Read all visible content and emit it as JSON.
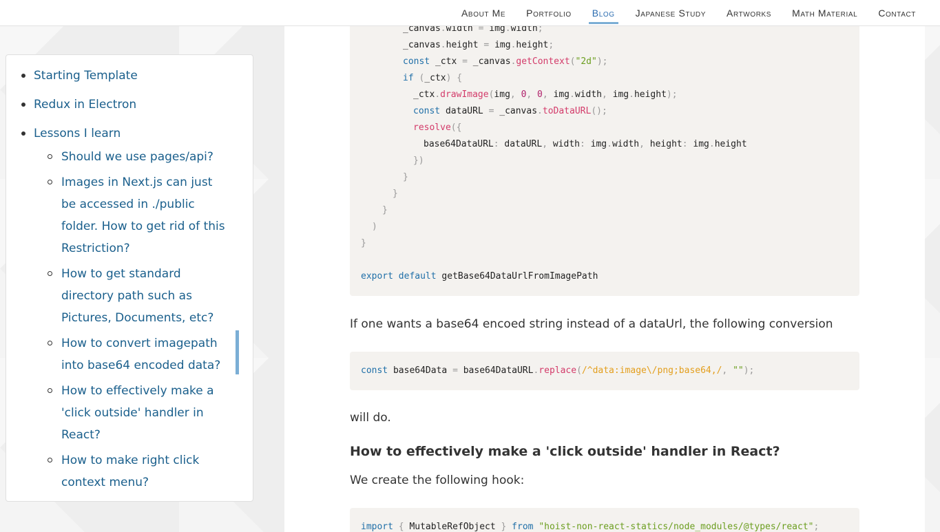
{
  "nav": {
    "items": [
      {
        "label": "About Me",
        "active": false
      },
      {
        "label": "Portfolio",
        "active": false
      },
      {
        "label": "Blog",
        "active": true
      },
      {
        "label": "Japanese Study",
        "active": false
      },
      {
        "label": "Artworks",
        "active": false
      },
      {
        "label": "Math Material",
        "active": false
      },
      {
        "label": "Contact",
        "active": false
      }
    ],
    "accent_color": "#7baed5"
  },
  "toc": {
    "items": [
      {
        "label": "Starting Template"
      },
      {
        "label": "Redux in Electron"
      },
      {
        "label": "Lessons I learn"
      }
    ],
    "sub_items": [
      {
        "label": "Should we use pages/api?"
      },
      {
        "label": "Images in Next.js can just be accessed in ./public folder. How to get rid of this Restriction?"
      },
      {
        "label": "How to get standard directory path such as Pictures, Documents, etc?"
      },
      {
        "label": "How to convert imagepath into base64 encoded data?"
      },
      {
        "label": "How to effectively make a 'click outside' handler in React?"
      },
      {
        "label": "How to make right click context menu?"
      }
    ]
  },
  "code1": {
    "l1_a": "_canvas",
    "l1_b": ".",
    "l1_c": "width",
    "l1_d": " = ",
    "l1_e": "img",
    "l1_f": ".",
    "l1_g": "width",
    "l1_h": ";",
    "l2_a": "_canvas",
    "l2_b": ".",
    "l2_c": "height",
    "l2_d": " = ",
    "l2_e": "img",
    "l2_f": ".",
    "l2_g": "height",
    "l2_h": ";",
    "l3_kw": "const",
    "l3_a": " _ctx ",
    "l3_b": "=",
    "l3_c": " _canvas",
    "l3_d": ".",
    "l3_fn": "getContext",
    "l3_e": "(",
    "l3_str": "\"2d\"",
    "l3_f": ");",
    "l4_kw": "if",
    "l4_a": " (",
    "l4_b": "_ctx",
    "l4_c": ") {",
    "l5_a": "_ctx",
    "l5_b": ".",
    "l5_fn": "drawImage",
    "l5_c": "(",
    "l5_d": "img",
    "l5_e": ", ",
    "l5_n1": "0",
    "l5_f": ", ",
    "l5_n2": "0",
    "l5_g": ", ",
    "l5_h": "img",
    "l5_i": ".",
    "l5_j": "width",
    "l5_k": ", ",
    "l5_l": "img",
    "l5_m": ".",
    "l5_n": "height",
    "l5_o": ");",
    "l6_kw": "const",
    "l6_a": " dataURL ",
    "l6_b": "=",
    "l6_c": " _canvas",
    "l6_d": ".",
    "l6_fn": "toDataURL",
    "l6_e": "();",
    "l7_fn": "resolve",
    "l7_a": "({",
    "l8_a": "base64DataURL",
    "l8_b": ":",
    "l8_c": " dataURL",
    "l8_d": ", ",
    "l8_e": "width",
    "l8_f": ":",
    "l8_g": " img",
    "l8_h": ".",
    "l8_i": "width",
    "l8_j": ", ",
    "l8_k": "height",
    "l8_l": ":",
    "l8_m": " img",
    "l8_n": ".",
    "l8_o": "height",
    "l9": "})",
    "l10": "}",
    "l11": "}",
    "l12": "}",
    "l13": ")",
    "l14": "}",
    "l15_kw1": "export",
    "l15_kw2": " default",
    "l15_a": " getBase64DataUrlFromImagePath"
  },
  "para1": "If one wants a base64 encoed string instead of a dataUrl, the following conversion",
  "code2": {
    "kw": "const",
    "a": " base64Data ",
    "b": "=",
    "c": " base64DataURL",
    "d": ".",
    "fn": "replace",
    "e": "(",
    "rx": "/^data:image\\/png;base64,/",
    "f": ", ",
    "str": "\"\"",
    "g": ");"
  },
  "para2": "will do.",
  "heading1": "How to effectively make a 'click outside' handler in React?",
  "para3": "We create the following hook:",
  "code3": {
    "kw1": "import",
    "a": " { ",
    "b": "MutableRefObject",
    "c": " } ",
    "kw2": "from",
    "d": " ",
    "str": "\"hoist-non-react-statics/node_modules/@types/react\"",
    "e": ";"
  }
}
